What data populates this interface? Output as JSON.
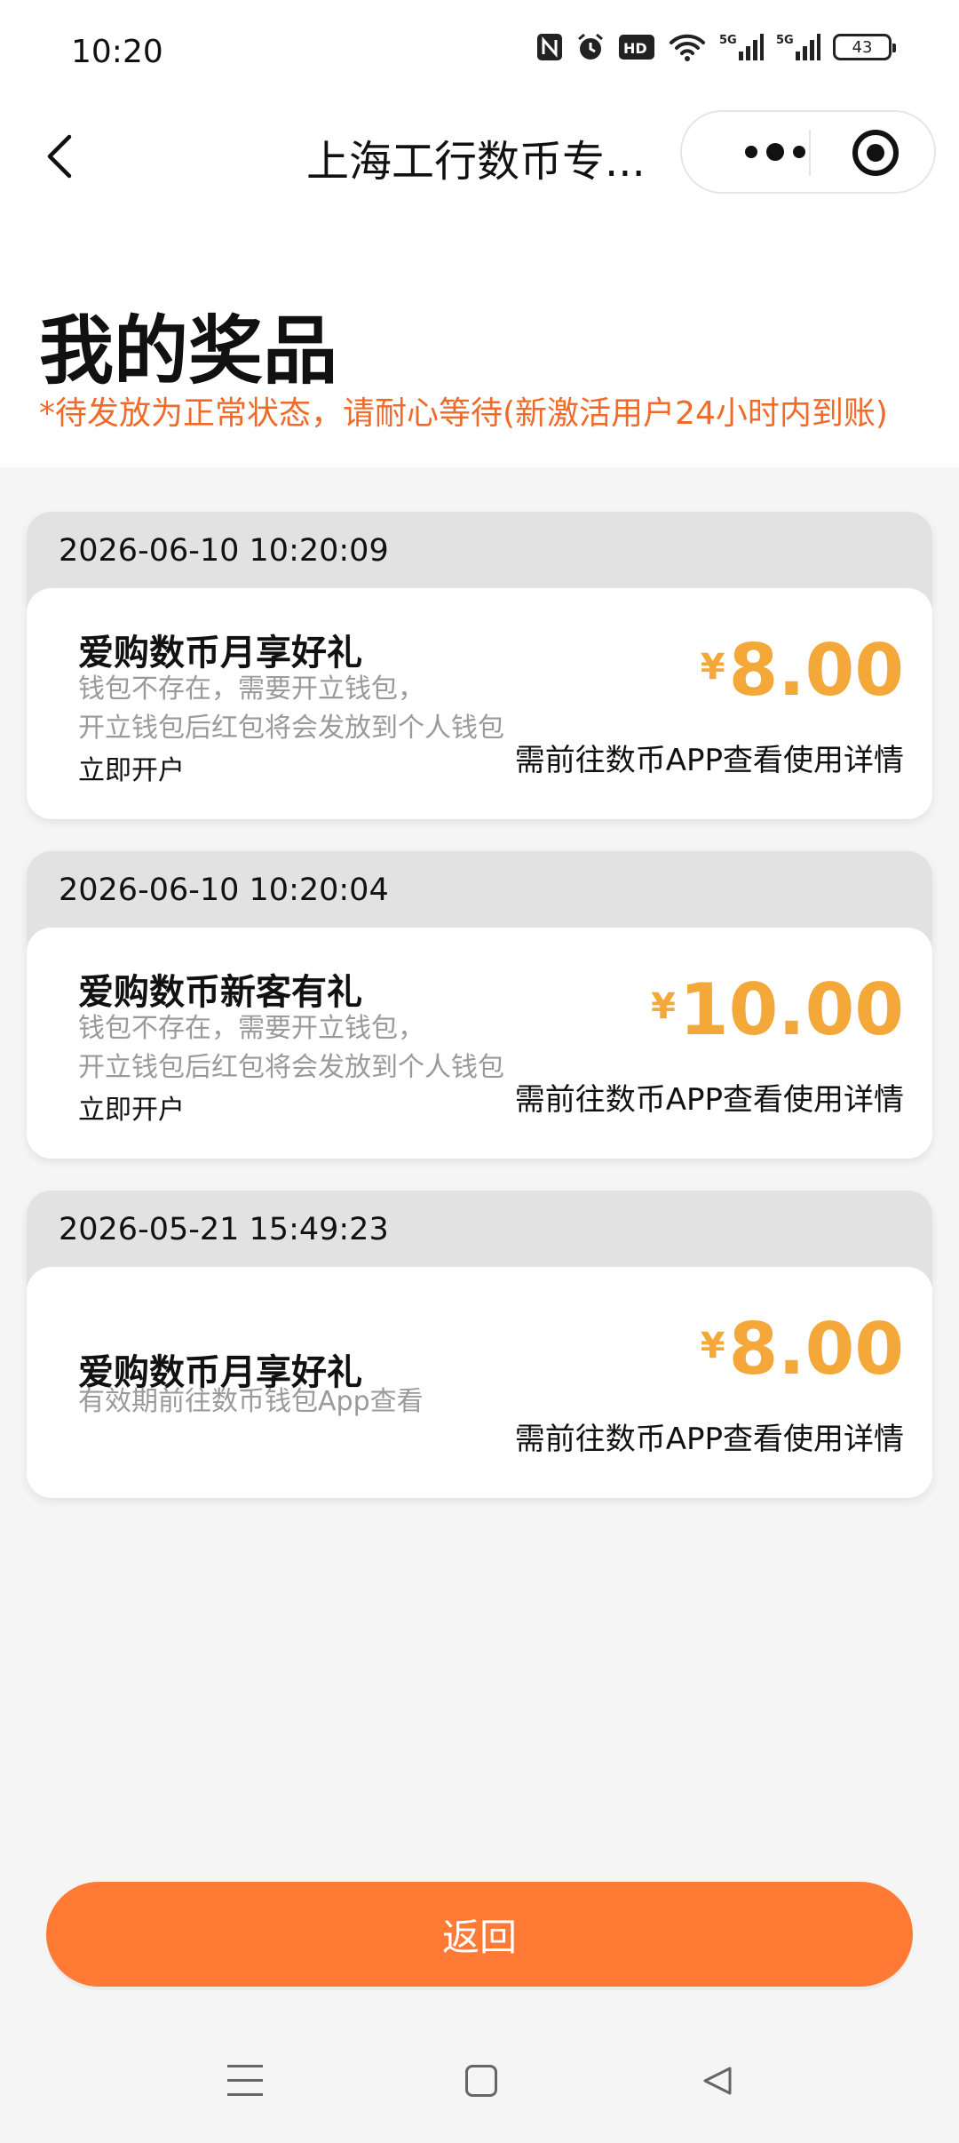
{
  "status_bar": {
    "time": "10:20",
    "battery": "43",
    "icons": [
      "nfc-icon",
      "alarm-icon",
      "hd-icon",
      "wifi-icon",
      "5g-signal-icon",
      "5g-signal-icon"
    ]
  },
  "navbar": {
    "title": "上海工行数币专..."
  },
  "header": {
    "title": "我的奖品",
    "notice": "*待发放为正常状态，请耐心等待(新激活用户24小时内到账)"
  },
  "currency_symbol": "¥",
  "cards": [
    {
      "timestamp": "2026-06-10 10:20:09",
      "name": "爱购数币月享好礼",
      "desc_line1": "钱包不存在，需要开立钱包，",
      "desc_line2": "开立钱包后红包将会发放到个人钱包",
      "action": "立即开户",
      "amount": "8.00",
      "detail": "需前往数币APP查看使用详情"
    },
    {
      "timestamp": "2026-06-10 10:20:04",
      "name": "爱购数币新客有礼",
      "desc_line1": "钱包不存在，需要开立钱包，",
      "desc_line2": "开立钱包后红包将会发放到个人钱包",
      "action": "立即开户",
      "amount": "10.00",
      "detail": "需前往数币APP查看使用详情"
    },
    {
      "timestamp": "2026-05-21 15:49:23",
      "name": "爱购数币月享好礼",
      "desc_line1": "有效期前往数币钱包App查看",
      "amount": "8.00",
      "detail": "需前往数币APP查看使用详情"
    }
  ],
  "return_button": "返回",
  "colors": {
    "accent": "#ff7a35",
    "notice": "#f06a2a",
    "amount": "#f4a83a"
  }
}
